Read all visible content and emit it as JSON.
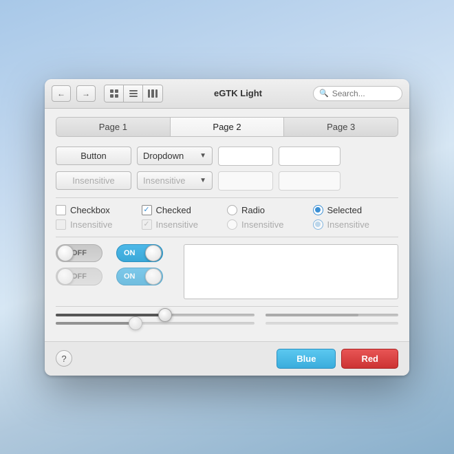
{
  "titlebar": {
    "title": "eGTK Light",
    "search_placeholder": "Search..."
  },
  "tabs": [
    {
      "label": "Page 1",
      "active": false
    },
    {
      "label": "Page 2",
      "active": true
    },
    {
      "label": "Page 3",
      "active": false
    }
  ],
  "row1": {
    "button_label": "Button",
    "dropdown_label": "Dropdown",
    "insensitive_btn_label": "Insensitive",
    "insensitive_drop_label": "Insensitive"
  },
  "checkboxes": {
    "checkbox_label": "Checkbox",
    "checked_label": "Checked",
    "insensitive_cb_label": "Insensitive",
    "insensitive_ch_label": "Insensitive"
  },
  "radios": {
    "radio_label": "Radio",
    "selected_label": "Selected",
    "insensitive_r1_label": "Insensitive",
    "insensitive_r2_label": "Insensitive"
  },
  "toggles": {
    "off_label": "OFF",
    "on_label": "ON"
  },
  "bottom": {
    "help_label": "?",
    "blue_btn": "Blue",
    "red_btn": "Red"
  }
}
